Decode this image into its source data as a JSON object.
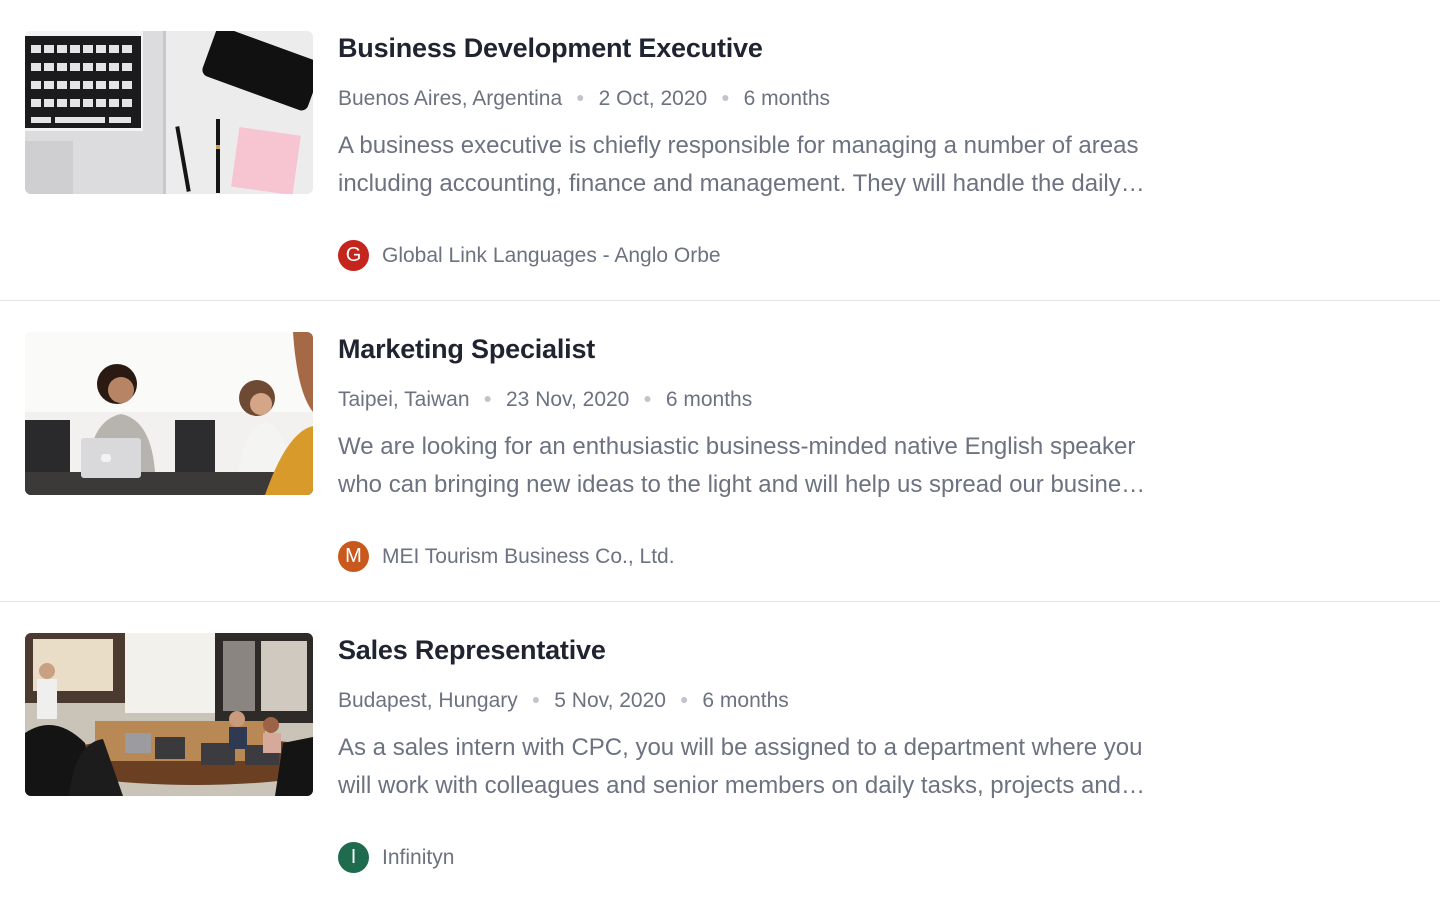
{
  "jobs": [
    {
      "title": "Business Development Executive",
      "location": "Buenos Aires, Argentina",
      "date": "2 Oct, 2020",
      "duration": "6 months",
      "description": "A business executive is chiefly responsible for managing a number of areas including accounting, finance and management. They will handle the daily…",
      "company": {
        "initial": "G",
        "name": "Global Link Languages - Anglo Orbe",
        "color": "#c4261d"
      },
      "image": "laptop-desk-photo"
    },
    {
      "title": "Marketing Specialist",
      "location": "Taipei, Taiwan",
      "date": "23 Nov, 2020",
      "duration": "6 months",
      "description": "We are looking for an enthusiastic business-minded native English speaker who can bringing new ideas to the light and will help us spread our busine…",
      "company": {
        "initial": "M",
        "name": "MEI Tourism Business Co., Ltd.",
        "color": "#c9581c"
      },
      "image": "office-meeting-photo"
    },
    {
      "title": "Sales Representative",
      "location": "Budapest, Hungary",
      "date": "5 Nov, 2020",
      "duration": "6 months",
      "description": "As a sales intern with CPC, you will be assigned to a department where you will work with colleagues and senior members on daily tasks, projects and…",
      "company": {
        "initial": "I",
        "name": "Infinityn",
        "color": "#1e6b4d"
      },
      "image": "conference-room-photo"
    }
  ]
}
